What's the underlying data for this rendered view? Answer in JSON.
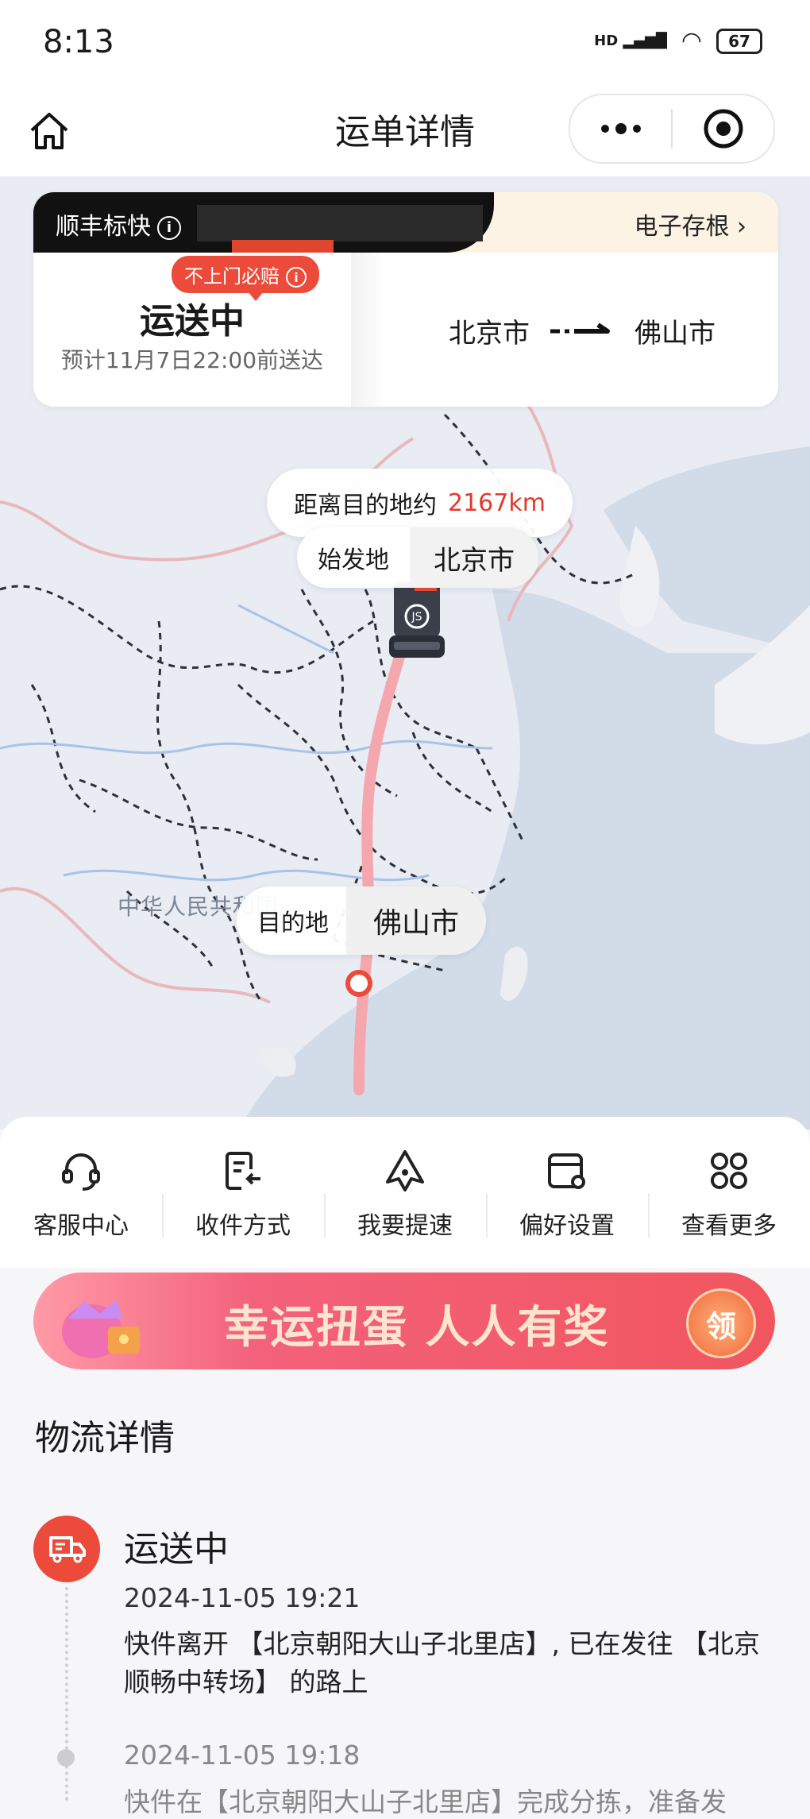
{
  "status_bar": {
    "time": "8:13",
    "signal": "HD",
    "battery": "67"
  },
  "header": {
    "title": "运单详情"
  },
  "card": {
    "service": "顺丰标快",
    "info_glyph": "i",
    "stub_link": "电子存根",
    "badge": "不上门必赔",
    "status": "运送中",
    "eta": "预计11月7日22:00前送达",
    "from": "北京市",
    "to": "佛山市"
  },
  "map": {
    "distance_label": "距离目的地约",
    "distance_value": "2167km",
    "origin_label": "始发地",
    "origin_city": "北京市",
    "dest_label": "目的地",
    "dest_city": "佛山市",
    "country_label": "中华人民共和国",
    "truck_logo": "JS"
  },
  "actions": [
    {
      "label": "客服中心",
      "icon": "headset-icon"
    },
    {
      "label": "收件方式",
      "icon": "receive-method-icon"
    },
    {
      "label": "我要提速",
      "icon": "speed-up-icon"
    },
    {
      "label": "偏好设置",
      "icon": "preference-icon"
    },
    {
      "label": "查看更多",
      "icon": "more-grid-icon"
    }
  ],
  "banner": {
    "text": "幸运扭蛋 人人有奖",
    "button": "领"
  },
  "logistics": {
    "title": "物流详情",
    "current_status": "运送中",
    "events": [
      {
        "time": "2024-11-05 19:21",
        "text": "快件离开 【北京朝阳大山子北里店】, 已在发往 【北京顺畅中转场】 的路上"
      },
      {
        "time": "2024-11-05 19:18",
        "text": "快件在【北京朝阳大山子北里店】完成分拣，准备发"
      }
    ]
  },
  "colors": {
    "accent_red": "#ec4a3a",
    "route_pink": "#f4a7ad",
    "map_bg": "#e9ecf2"
  }
}
